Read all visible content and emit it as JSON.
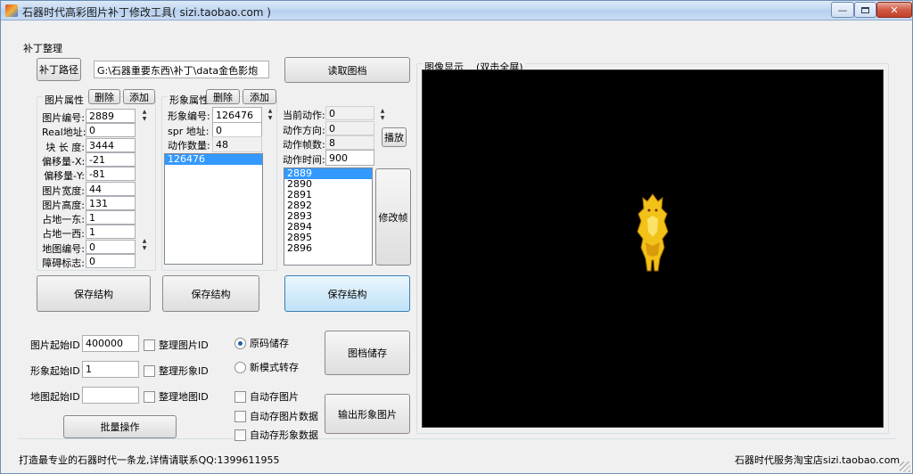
{
  "window": {
    "title": "石器时代高彩图片补丁修改工具( sizi.taobao.com )",
    "controls": [
      "minimize",
      "maximize",
      "close"
    ]
  },
  "group_title": "补丁整理",
  "patch": {
    "path_button": "补丁路径",
    "path_value": "G:\\石器重要东西\\补丁\\data金色影炮",
    "read_button": "读取图档"
  },
  "image_props": {
    "title": "图片属性",
    "delete": "删除",
    "add": "添加",
    "fields": [
      {
        "label": "图片编号:",
        "value": "2889"
      },
      {
        "label": "Real地址:",
        "value": "0"
      },
      {
        "label": "块 长 度:",
        "value": "3444"
      },
      {
        "label": "偏移量-X:",
        "value": "-21"
      },
      {
        "label": "偏移量-Y:",
        "value": "-81"
      },
      {
        "label": "图片宽度:",
        "value": "44"
      },
      {
        "label": "图片高度:",
        "value": "131"
      },
      {
        "label": "占地一东:",
        "value": "1"
      },
      {
        "label": "占地一西:",
        "value": "1"
      },
      {
        "label": "地图编号:",
        "value": "0"
      },
      {
        "label": "障碍标志:",
        "value": "0"
      }
    ],
    "save": "保存结构"
  },
  "shape_props": {
    "title": "形象属性",
    "delete": "删除",
    "add": "添加",
    "shape_no_label": "形象编号:",
    "shape_no_value": "126476",
    "spr_label": "spr  地址:",
    "spr_value": "0",
    "action_count_label": "动作数量:",
    "action_count_value": "48",
    "list": [
      "126476"
    ],
    "save": "保存结构"
  },
  "action_props": {
    "current_action_label": "当前动作:",
    "current_action_value": "0",
    "direction_label": "动作方向:",
    "direction_value": "0",
    "frames_label": "动作帧数:",
    "frames_value": "8",
    "time_label": "动作时间:",
    "time_value": "900",
    "play": "播放",
    "edit_frame": "修改帧",
    "frames_list": [
      "2889",
      "2890",
      "2891",
      "2892",
      "2893",
      "2894",
      "2895",
      "2896"
    ],
    "save": "保存结构"
  },
  "preview": {
    "title": "图像显示    (双击全屏)"
  },
  "ids": {
    "image_start_label": "图片起始ID",
    "image_start_value": "400000",
    "image_check": "整理图片ID",
    "shape_start_label": "形象起始ID",
    "shape_start_value": "1",
    "shape_check": "整理形象ID",
    "map_start_label": "地图起始ID",
    "map_start_value": "",
    "map_check": "整理地图ID",
    "batch": "批量操作"
  },
  "save_mode": {
    "original": "原码储存",
    "new_mode": "新模式转存",
    "selected": "original",
    "save_button": "图档储存",
    "export_button": "输出形象图片",
    "auto_save_image": "自动存图片",
    "auto_save_image_data": "自动存图片数据",
    "auto_save_shape_data": "自动存形象数据"
  },
  "status": {
    "left": "打造最专业的石器时代一条龙,详情请联系QQ:1399611955",
    "right": "石器时代服务淘宝店sizi.taobao.com"
  },
  "colors": {
    "canvas": "#000000",
    "selection": "#3399ff",
    "sprite_gold": "#f2c218"
  }
}
